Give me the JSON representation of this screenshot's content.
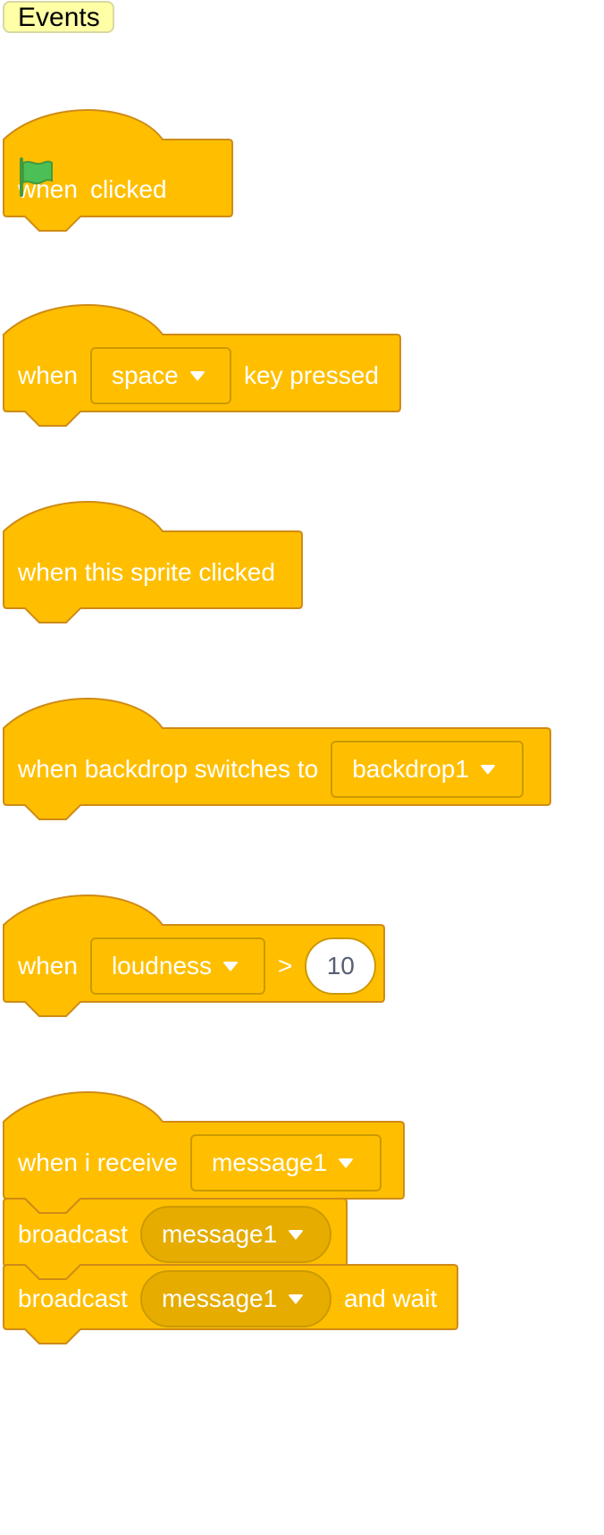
{
  "palette": {
    "category_label": "Events",
    "colors": {
      "block_fill": "#ffbf00",
      "block_stroke": "#cf8b17",
      "dropdown_round_fill": "#e6ac00",
      "flag_green": "#4cbf56"
    },
    "blocks": {
      "flag_clicked": {
        "when": "when",
        "flag_icon": "green-flag-icon",
        "clicked": "clicked"
      },
      "key_pressed": {
        "when": "when",
        "key": "space",
        "key_pressed": "key pressed"
      },
      "sprite_clicked": {
        "label": "when this sprite clicked"
      },
      "backdrop_switches": {
        "label": "when backdrop switches to",
        "backdrop": "backdrop1"
      },
      "greater_than": {
        "when": "when",
        "sensor": "loudness",
        "op": ">",
        "value": "10"
      },
      "receive": {
        "label": "when i receive",
        "message": "message1"
      },
      "broadcast": {
        "label": "broadcast",
        "message": "message1"
      },
      "broadcast_wait": {
        "label": "broadcast",
        "message": "message1",
        "suffix": "and wait"
      }
    }
  }
}
